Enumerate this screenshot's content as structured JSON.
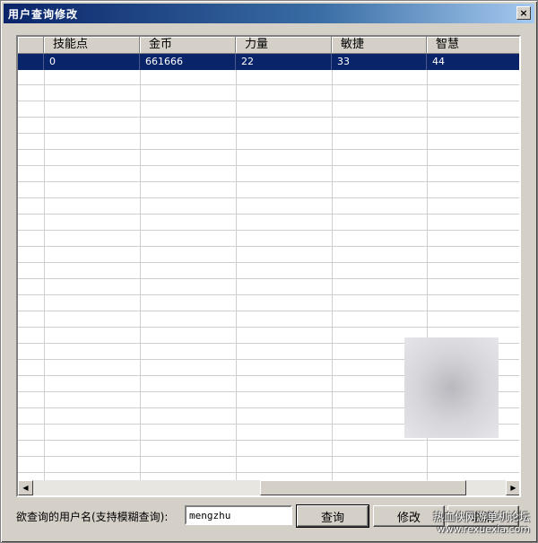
{
  "window": {
    "title": "用户查询修改",
    "close_glyph": "×"
  },
  "grid": {
    "columns": [
      "",
      "技能点",
      "金币",
      "力量",
      "敏捷",
      "智慧"
    ],
    "rows": [
      [
        "",
        "0",
        "661666",
        "22",
        "33",
        "44"
      ]
    ]
  },
  "scrollbar": {
    "left_glyph": "◀",
    "right_glyph": "▶"
  },
  "footer": {
    "query_label": "欲查询的用户名(支持模糊查询):",
    "username_value": "mengzhu",
    "query_button": "查询",
    "modify_button": "修改",
    "cancel_button": "取消"
  },
  "watermark": {
    "line1": "热血侠网游单机论坛",
    "line2": "www.rexuexia.com"
  },
  "colors": {
    "title_bar": "#0a246a",
    "selection": "#0a246a",
    "face": "#d4d0c8"
  }
}
